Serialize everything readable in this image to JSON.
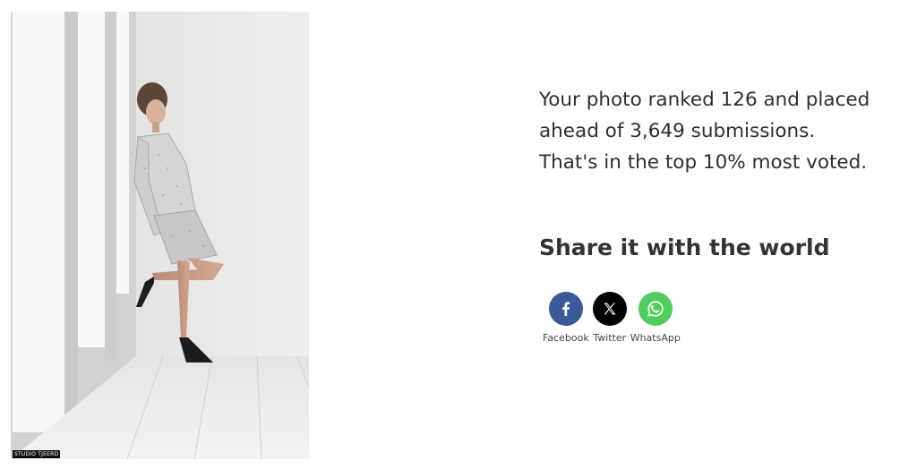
{
  "photo": {
    "watermark": "STUDIO TJEERD"
  },
  "result": {
    "line1": "Your photo ranked 126 and placed",
    "line2": "ahead of 3,649 submissions.",
    "line3": "That's in the top 10% most voted."
  },
  "share": {
    "title": "Share it with the world",
    "buttons": [
      {
        "label": "Facebook",
        "icon": "facebook-icon",
        "color": "#3b5998"
      },
      {
        "label": "Twitter",
        "icon": "x-icon",
        "color": "#000000"
      },
      {
        "label": "WhatsApp",
        "icon": "whatsapp-icon",
        "color": "#4fce5d"
      }
    ]
  }
}
